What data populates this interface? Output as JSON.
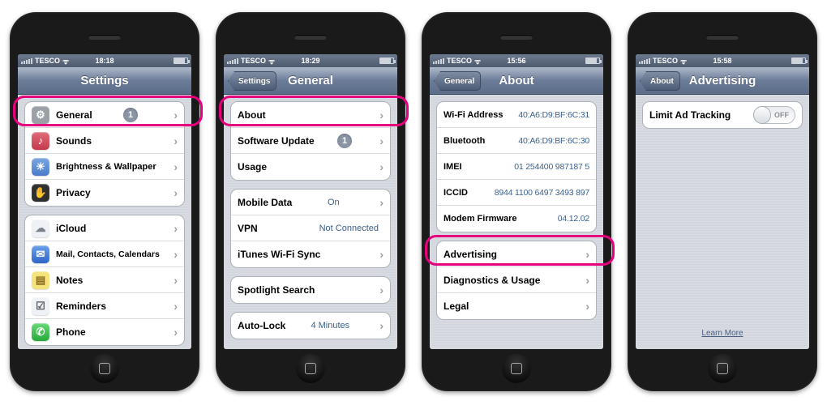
{
  "status": {
    "carrier": "TESCO"
  },
  "phones": [
    {
      "time": "18:18",
      "title": "Settings",
      "back": null,
      "highlight_row": 0,
      "groups": [
        {
          "rows": [
            {
              "icon": {
                "bg": "#9aa0a6",
                "glyph": "⚙"
              },
              "label": "General",
              "badge": "1",
              "chevron": true
            },
            {
              "icon": {
                "bg": "#d14b5a",
                "glyph": "♪"
              },
              "label": "Sounds",
              "chevron": true
            },
            {
              "icon": {
                "bg": "#5b8fd6",
                "glyph": "☀"
              },
              "label": "Brightness & Wallpaper",
              "chevron": true
            },
            {
              "icon": {
                "bg": "#3a3a3a",
                "glyph": "✋"
              },
              "label": "Privacy",
              "chevron": true
            }
          ]
        },
        {
          "rows": [
            {
              "icon": {
                "bg": "#eef1f5",
                "glyph": "☁",
                "fg": "#7a828c"
              },
              "label": "iCloud",
              "chevron": true
            },
            {
              "icon": {
                "bg": "#3f7fe0",
                "glyph": "✉"
              },
              "label": "Mail, Contacts, Calendars",
              "chevron": true
            },
            {
              "icon": {
                "bg": "#f4e27a",
                "glyph": "▤",
                "fg": "#8a6b1f"
              },
              "label": "Notes",
              "chevron": true
            },
            {
              "icon": {
                "bg": "#eef1f5",
                "glyph": "☑",
                "fg": "#555"
              },
              "label": "Reminders",
              "chevron": true
            },
            {
              "icon": {
                "bg": "#36c24a",
                "glyph": "✆"
              },
              "label": "Phone",
              "chevron": true
            }
          ]
        }
      ]
    },
    {
      "time": "18:29",
      "title": "General",
      "back": "Settings",
      "highlight_row": 0,
      "groups": [
        {
          "rows": [
            {
              "label": "About",
              "chevron": true
            },
            {
              "label": "Software Update",
              "badge": "1",
              "chevron": true
            },
            {
              "label": "Usage",
              "chevron": true
            }
          ]
        },
        {
          "rows": [
            {
              "label": "Mobile Data",
              "value": "On",
              "chevron": true
            },
            {
              "label": "VPN",
              "value": "Not Connected",
              "value_gray": true
            },
            {
              "label": "iTunes Wi-Fi Sync",
              "chevron": true
            }
          ]
        },
        {
          "rows": [
            {
              "label": "Spotlight Search",
              "chevron": true
            }
          ]
        },
        {
          "rows": [
            {
              "label": "Auto-Lock",
              "value": "4 Minutes",
              "chevron": true
            }
          ]
        }
      ]
    },
    {
      "time": "15:56",
      "title": "About",
      "back": "General",
      "highlight_group": 1,
      "highlight_group_row": 0,
      "groups": [
        {
          "rows": [
            {
              "label": "Wi-Fi Address",
              "value": "40:A6:D9:BF:6C:31",
              "tight": true
            },
            {
              "label": "Bluetooth",
              "value": "40:A6:D9:BF:6C:30",
              "tight": true
            },
            {
              "label": "IMEI",
              "value": "01 254400 987187 5",
              "tight": true
            },
            {
              "label": "ICCID",
              "value": "8944 1100 6497 3493 897",
              "tight": true
            },
            {
              "label": "Modem Firmware",
              "value": "04.12.02",
              "tight": true
            }
          ]
        },
        {
          "rows": [
            {
              "label": "Advertising",
              "chevron": true
            },
            {
              "label": "Diagnostics & Usage",
              "chevron": true
            },
            {
              "label": "Legal",
              "chevron": true
            }
          ]
        }
      ]
    },
    {
      "time": "15:58",
      "title": "Advertising",
      "back": "About",
      "learn_more": "Learn More",
      "groups": [
        {
          "rows": [
            {
              "label": "Limit Ad Tracking",
              "toggle": "OFF"
            }
          ]
        }
      ]
    }
  ]
}
